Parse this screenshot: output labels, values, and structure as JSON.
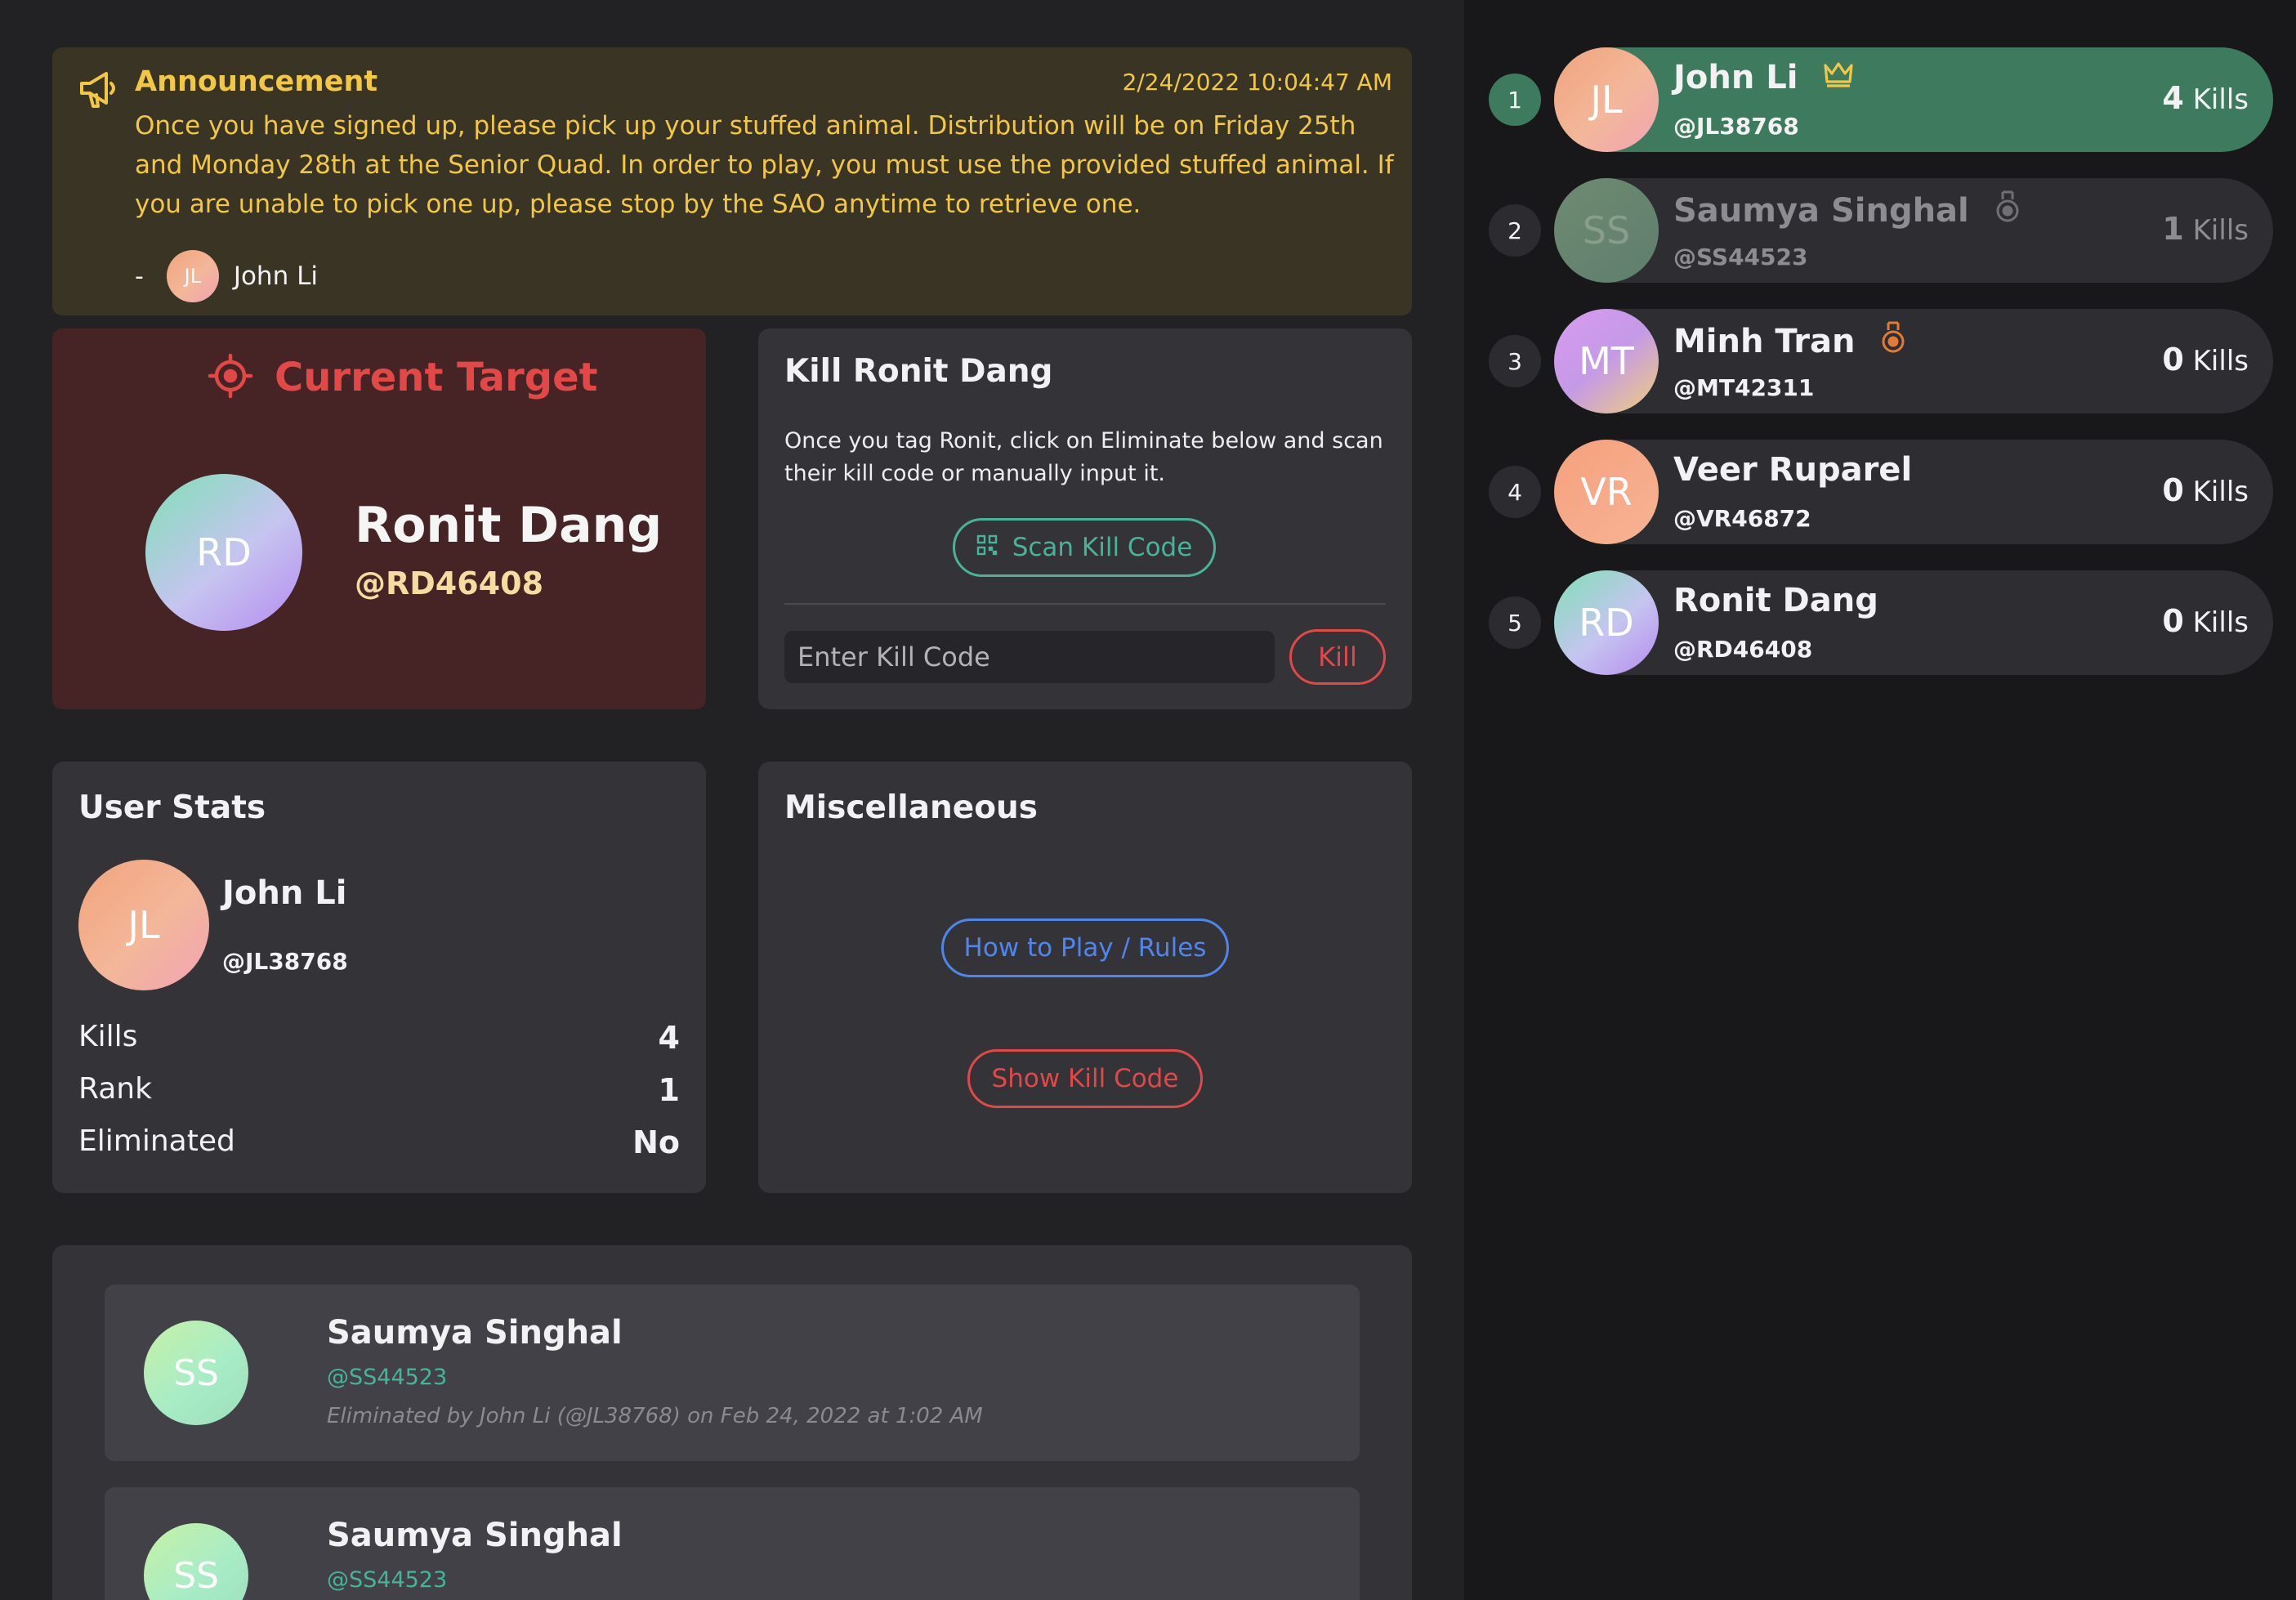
{
  "colors": {
    "accent_yellow": "#f2c744",
    "accent_red": "#e24848",
    "accent_teal": "#49b39a",
    "accent_blue": "#4f86ee",
    "leader_green": "#3d7a5e"
  },
  "announcement": {
    "icon": "megaphone-icon",
    "title": "Announcement",
    "date": "2/24/2022 10:04:47 AM",
    "body": "Once you have signed up, please pick up your stuffed animal. Distribution will be on Friday 25th and Monday 28th at the Senior Quad. In order to play, you must use the provided stuffed animal. If you are unable to pick one up, please stop by the SAO anytime to retrieve one.",
    "signature_dash": "-",
    "author_initials": "JL",
    "author_name": "John Li"
  },
  "target": {
    "icon": "crosshair-icon",
    "heading": "Current Target",
    "initials": "RD",
    "name": "Ronit Dang",
    "handle": "@RD46408"
  },
  "kill_card": {
    "title": "Kill Ronit Dang",
    "description": "Once you tag Ronit, click on Eliminate below and scan their kill code or manually input it.",
    "scan_icon": "qr-code-icon",
    "scan_label": "Scan Kill Code",
    "input_placeholder": "Enter Kill Code",
    "kill_label": "Kill"
  },
  "user_stats": {
    "title": "User Stats",
    "initials": "JL",
    "name": "John Li",
    "handle": "@JL38768",
    "rows": [
      {
        "label": "Kills",
        "value": "4"
      },
      {
        "label": "Rank",
        "value": "1"
      },
      {
        "label": "Eliminated",
        "value": "No"
      }
    ]
  },
  "misc": {
    "title": "Miscellaneous",
    "rules_label": "How to Play / Rules",
    "show_kill_code_label": "Show Kill Code"
  },
  "eliminations": [
    {
      "initials": "SS",
      "name": "Saumya Singhal",
      "handle": "@SS44523",
      "info": "Eliminated by John Li (@JL38768) on Feb 24, 2022 at 1:02 AM"
    },
    {
      "initials": "SS",
      "name": "Saumya Singhal",
      "handle": "@SS44523"
    }
  ],
  "leaderboard": [
    {
      "rank": "1",
      "initials": "JL",
      "name": "John Li",
      "handle": "@JL38768",
      "kills": "4",
      "kills_label": "Kills",
      "badge": "crown-icon"
    },
    {
      "rank": "2",
      "initials": "SS",
      "name": "Saumya Singhal",
      "handle": "@SS44523",
      "kills": "1",
      "kills_label": "Kills",
      "badge": "silver-medal-icon"
    },
    {
      "rank": "3",
      "initials": "MT",
      "name": "Minh Tran",
      "handle": "@MT42311",
      "kills": "0",
      "kills_label": "Kills",
      "badge": "bronze-medal-icon"
    },
    {
      "rank": "4",
      "initials": "VR",
      "name": "Veer Ruparel",
      "handle": "@VR46872",
      "kills": "0",
      "kills_label": "Kills"
    },
    {
      "rank": "5",
      "initials": "RD",
      "name": "Ronit Dang",
      "handle": "@RD46408",
      "kills": "0",
      "kills_label": "Kills"
    }
  ]
}
